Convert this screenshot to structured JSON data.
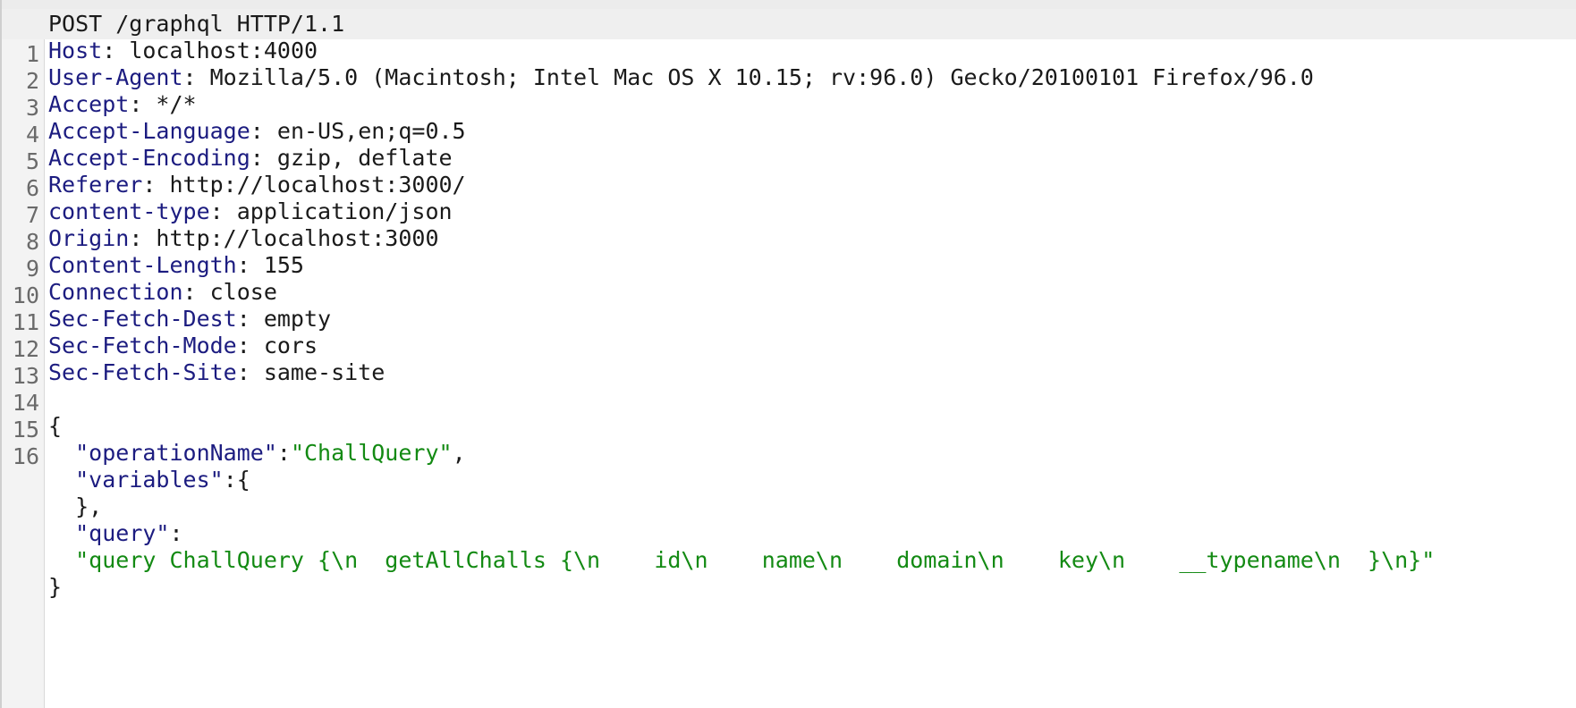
{
  "request_line": "POST /graphql HTTP/1.1",
  "headers": [
    {
      "name": "Host",
      "value": "localhost:4000"
    },
    {
      "name": "User-Agent",
      "value": "Mozilla/5.0 (Macintosh; Intel Mac OS X 10.15; rv:96.0) Gecko/20100101 Firefox/96.0"
    },
    {
      "name": "Accept",
      "value": "*/*"
    },
    {
      "name": "Accept-Language",
      "value": "en-US,en;q=0.5"
    },
    {
      "name": "Accept-Encoding",
      "value": "gzip, deflate"
    },
    {
      "name": "Referer",
      "value": "http://localhost:3000/"
    },
    {
      "name": "content-type",
      "value": "application/json"
    },
    {
      "name": "Origin",
      "value": "http://localhost:3000"
    },
    {
      "name": "Content-Length",
      "value": "155"
    },
    {
      "name": "Connection",
      "value": "close"
    },
    {
      "name": "Sec-Fetch-Dest",
      "value": "empty"
    },
    {
      "name": "Sec-Fetch-Mode",
      "value": "cors"
    },
    {
      "name": "Sec-Fetch-Site",
      "value": "same-site"
    }
  ],
  "line_numbers": [
    "1",
    "2",
    "3",
    "4",
    "5",
    "6",
    "7",
    "8",
    "9",
    "10",
    "11",
    "12",
    "13",
    "14",
    "15",
    "16"
  ],
  "body": {
    "open_brace": "{",
    "op_key": "\"operationName\"",
    "op_value": "\"ChallQuery\"",
    "vars_key": "\"variables\"",
    "vars_open": "{",
    "vars_close": "},",
    "query_key": "\"query\"",
    "query_value": "\"query ChallQuery {\\n  getAllChalls {\\n    id\\n    name\\n    domain\\n    key\\n    __typename\\n  }\\n}\"",
    "close_brace": "}"
  },
  "colors": {
    "header_name": "#1c1c80",
    "string_value": "#138a13",
    "text": "#1a1a1a",
    "gutter": "#f3f3f3",
    "current_line": "#efefef"
  }
}
